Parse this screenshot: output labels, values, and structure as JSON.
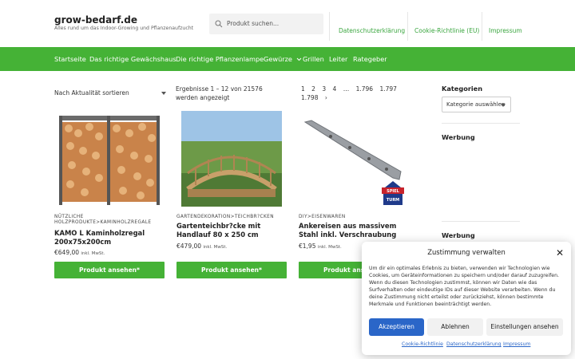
{
  "header": {
    "site_title": "grow-bedarf.de",
    "site_description": "Alles rund um das Indoor-Growing und Pflanzenaufzucht",
    "search_placeholder": "Produkt suchen...",
    "links": [
      "Datenschutzerklärung",
      "Cookie-Richtlinie (EU)",
      "Impressum"
    ]
  },
  "nav": {
    "items": [
      "Startseite",
      "Das richtige Gewächshaus",
      "Die richtige Pflanzenlampe",
      "Gewürze",
      "Grillen",
      "Leiter",
      "Rategeber"
    ]
  },
  "shop": {
    "sort_label": "Nach Aktualität sortieren",
    "results_text": "Ergebnisse 1 – 12 von 21576 werden angezeigt",
    "pager": [
      "1",
      "2",
      "3",
      "4",
      "…",
      "1.796",
      "1.797",
      "1.798",
      "›"
    ]
  },
  "products": [
    {
      "category": "NÜTZLICHE HOLZPRODUKTE>KAMINHOLZREGALE",
      "title": "KAMO L Kaminholzregal 200x75x200cm",
      "price": "€649,00",
      "price_note": "inkl. MwSt.",
      "button": "Produkt ansehen*"
    },
    {
      "category": "GARTENDEKORATION>TEICHBR?CKEN",
      "title": "Gartenteichbr?cke mit Handlauf 80 x 250 cm",
      "price": "€479,00",
      "price_note": "inkl. MwSt.",
      "button": "Produkt ansehen*"
    },
    {
      "category": "DIY>EISENWAREN",
      "title": "Ankereisen aus massivem Stahl inkl. Verschraubung",
      "price": "€1,95",
      "price_note": "inkl. MwSt.",
      "button": "Produkt ansehen*",
      "badge_text": "SPIEL TURM"
    }
  ],
  "sidebar": {
    "categories_heading": "Kategorien",
    "categories_select": "Kategorie auswählen",
    "ad_heading_1": "Werbung",
    "ad_heading_2": "Werbung"
  },
  "consent": {
    "title": "Zustimmung verwalten",
    "text": "Um dir ein optimales Erlebnis zu bieten, verwenden wir Technologien wie Cookies, um Geräteinformationen zu speichern und/oder darauf zuzugreifen. Wenn du diesen Technologien zustimmst, können wir Daten wie das Surfverhalten oder eindeutige IDs auf dieser Website verarbeiten. Wenn du deine Zustimmung nicht erteilst oder zurückziehst, können bestimmte Merkmale und Funktionen beeinträchtigt werden.",
    "accept": "Akzeptieren",
    "deny": "Ablehnen",
    "settings": "Einstellungen ansehen",
    "links": [
      "Cookie-Richtlinie",
      "Datenschutzerklärung",
      "Impressum"
    ]
  },
  "colors": {
    "accent": "#45b236",
    "link": "#3aa63f",
    "accept_button": "#2a66c8"
  }
}
